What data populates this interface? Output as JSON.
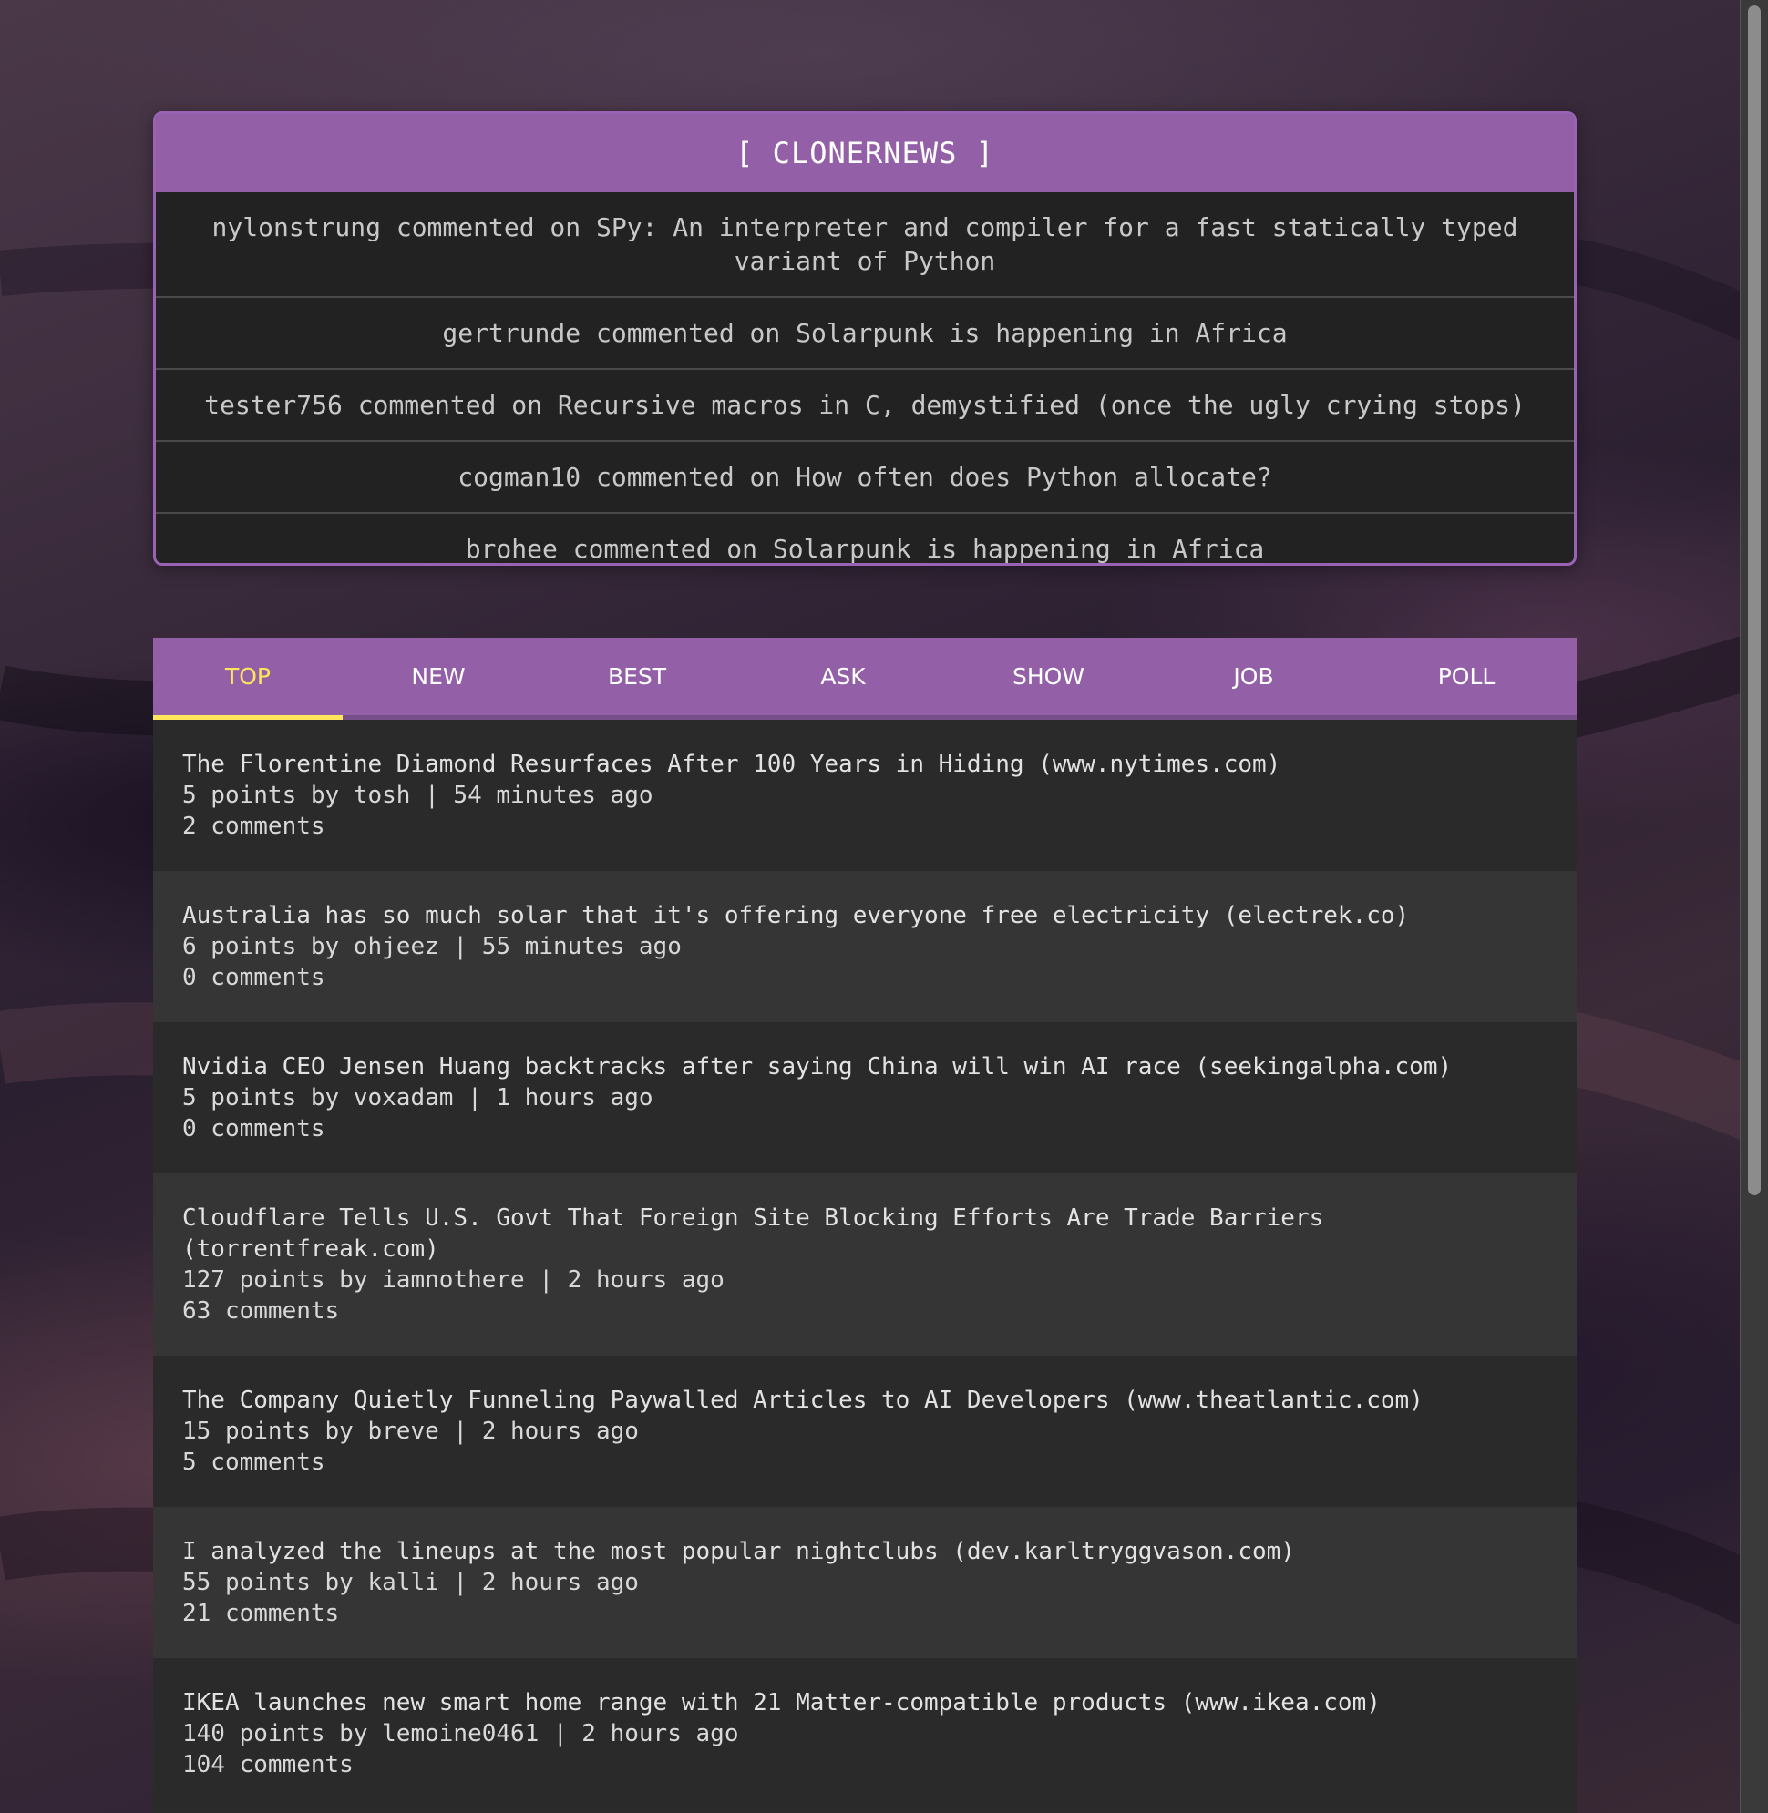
{
  "header": {
    "title": "[ CLONERNEWS ]"
  },
  "activity": [
    {
      "text": "nylonstrung commented on SPy: An interpreter and compiler for a fast statically typed variant of Python"
    },
    {
      "text": "gertrunde commented on Solarpunk is happening in Africa"
    },
    {
      "text": "tester756 commented on Recursive macros in C, demystified (once the ugly crying stops)"
    },
    {
      "text": "cogman10 commented on How often does Python allocate?"
    },
    {
      "text": "brohee commented on Solarpunk is happening in Africa"
    }
  ],
  "tabs": [
    {
      "label": "TOP",
      "active": true
    },
    {
      "label": "NEW",
      "active": false
    },
    {
      "label": "BEST",
      "active": false
    },
    {
      "label": "ASK",
      "active": false
    },
    {
      "label": "SHOW",
      "active": false
    },
    {
      "label": "JOB",
      "active": false
    },
    {
      "label": "POLL",
      "active": false
    }
  ],
  "stories": [
    {
      "title": "The Florentine Diamond Resurfaces After 100 Years in Hiding (www.nytimes.com)",
      "meta": "5 points by tosh | 54 minutes ago",
      "comments": "2 comments"
    },
    {
      "title": "Australia has so much solar that it's offering everyone free electricity (electrek.co)",
      "meta": "6 points by ohjeez | 55 minutes ago",
      "comments": "0 comments"
    },
    {
      "title": "Nvidia CEO Jensen Huang backtracks after saying China will win AI race (seekingalpha.com)",
      "meta": "5 points by voxadam | 1 hours ago",
      "comments": "0 comments"
    },
    {
      "title": "Cloudflare Tells U.S. Govt That Foreign Site Blocking Efforts Are Trade Barriers (torrentfreak.com)",
      "meta": "127 points by iamnothere | 2 hours ago",
      "comments": "63 comments"
    },
    {
      "title": "The Company Quietly Funneling Paywalled Articles to AI Developers (www.theatlantic.com)",
      "meta": "15 points by breve | 2 hours ago",
      "comments": "5 comments"
    },
    {
      "title": "I analyzed the lineups at the most popular nightclubs (dev.karltryggvason.com)",
      "meta": "55 points by kalli | 2 hours ago",
      "comments": "21 comments"
    },
    {
      "title": "IKEA launches new smart home range with 21 Matter-compatible products (www.ikea.com)",
      "meta": "140 points by lemoine0461 | 2 hours ago",
      "comments": "104 comments"
    }
  ],
  "colors": {
    "accent": "#9360a8",
    "active_tab": "#ffe55c"
  }
}
